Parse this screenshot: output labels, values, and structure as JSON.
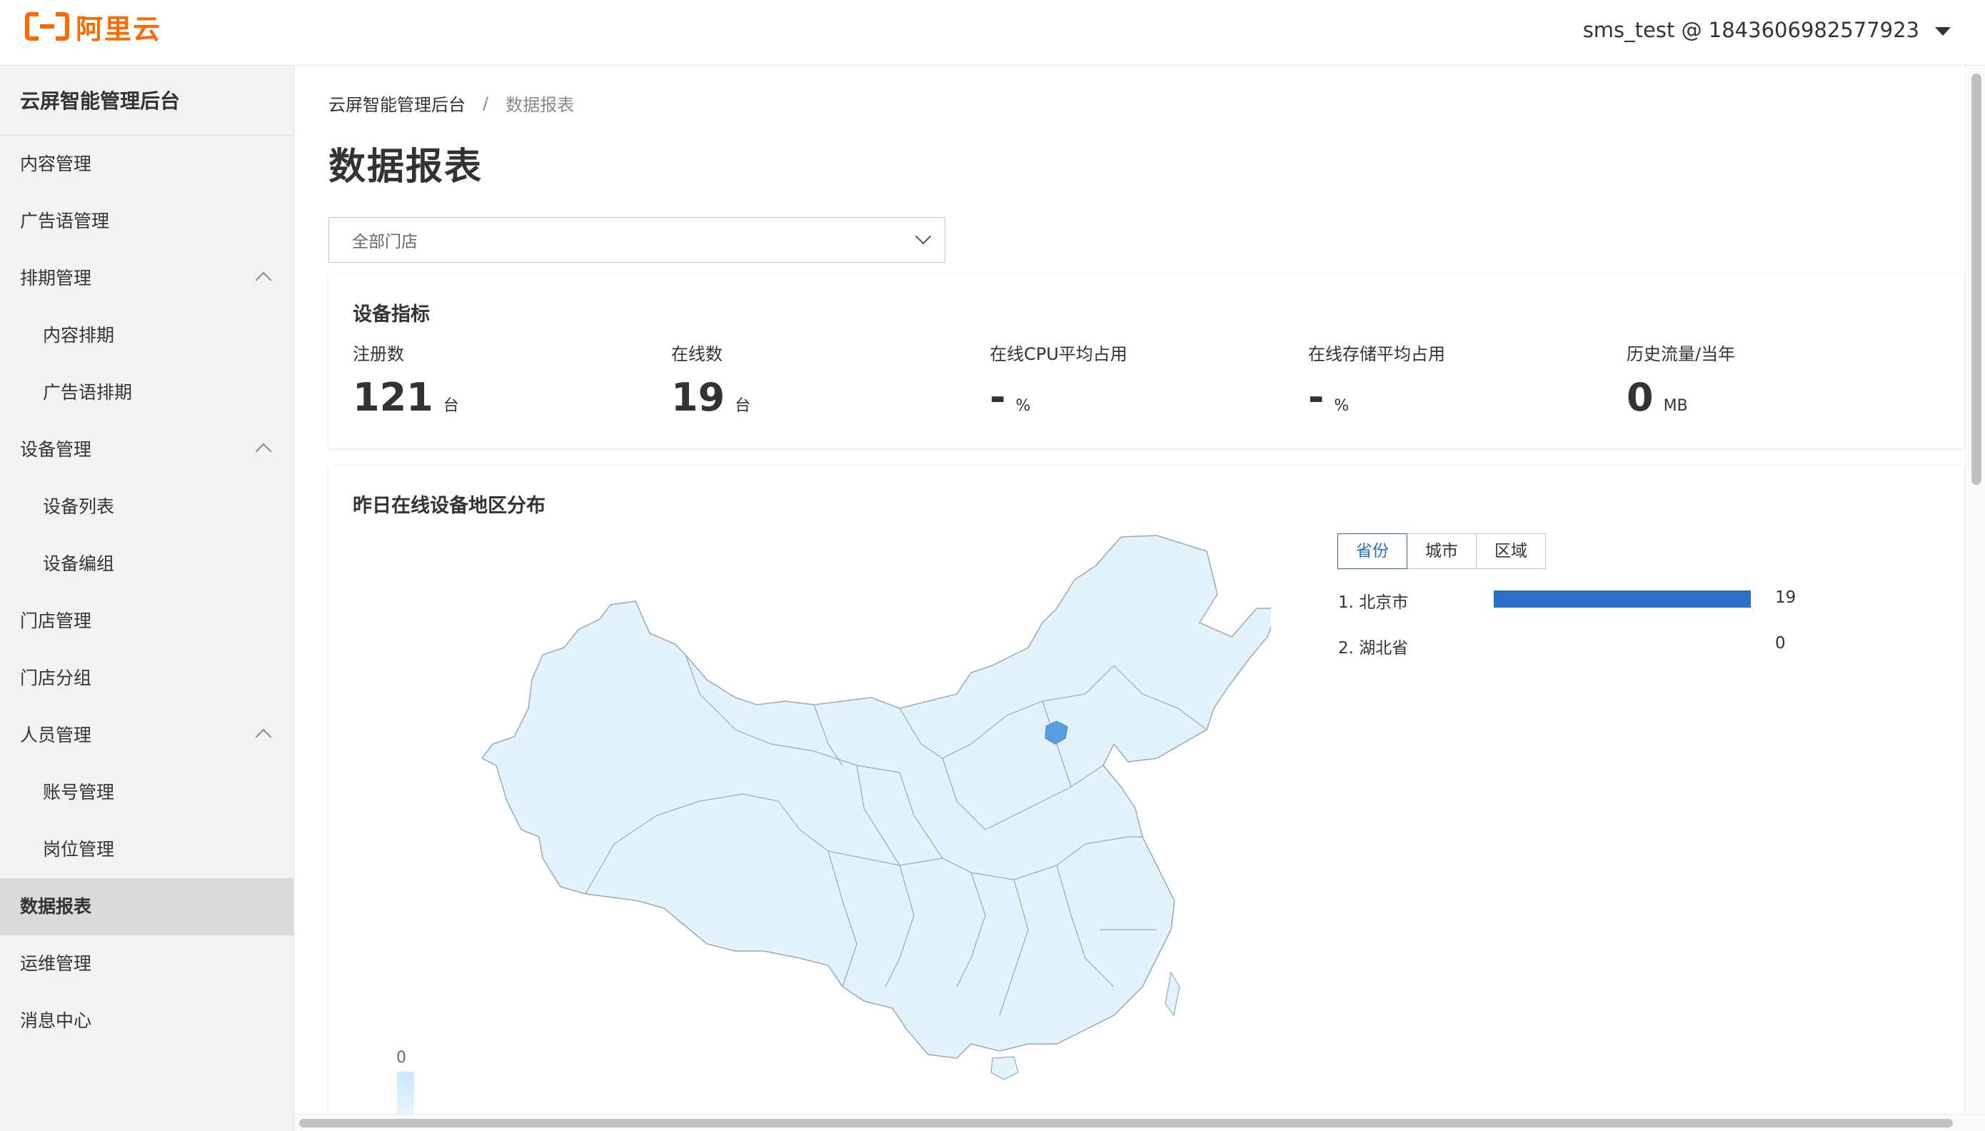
{
  "header": {
    "logo_text": "阿里云",
    "account": "sms_test @ 1843606982577923",
    "brand_color": "#ff6a00"
  },
  "sidebar": {
    "title": "云屏智能管理后台",
    "items": [
      {
        "label": "内容管理"
      },
      {
        "label": "广告语管理"
      },
      {
        "label": "排期管理"
      },
      {
        "label": "内容排期"
      },
      {
        "label": "广告语排期"
      },
      {
        "label": "设备管理"
      },
      {
        "label": "设备列表"
      },
      {
        "label": "设备编组"
      },
      {
        "label": "门店管理"
      },
      {
        "label": "门店分组"
      },
      {
        "label": "人员管理"
      },
      {
        "label": "账号管理"
      },
      {
        "label": "岗位管理"
      },
      {
        "label": "数据报表"
      },
      {
        "label": "运维管理"
      },
      {
        "label": "消息中心"
      }
    ]
  },
  "breadcrumb": {
    "root": "云屏智能管理后台",
    "separator": "/",
    "current": "数据报表"
  },
  "page": {
    "title": "数据报表",
    "store_select": "全部门店"
  },
  "metrics": {
    "title": "设备指标",
    "items": [
      {
        "label": "注册数",
        "value": "121",
        "unit": "台"
      },
      {
        "label": "在线数",
        "value": "19",
        "unit": "台"
      },
      {
        "label": "在线CPU平均占用",
        "value": "-",
        "unit": "%"
      },
      {
        "label": "在线存储平均占用",
        "value": "-",
        "unit": "%"
      },
      {
        "label": "历史流量/当年",
        "value": "0",
        "unit": "MB"
      }
    ]
  },
  "distribution": {
    "title": "昨日在线设备地区分布",
    "legend_min": "0",
    "tabs": [
      "省份",
      "城市",
      "区域"
    ],
    "active_tab": "省份",
    "ranking": [
      {
        "label": "1. 北京市",
        "value": "19",
        "fraction": 1.0
      },
      {
        "label": "2. 湖北省",
        "value": "0",
        "fraction": 0.0
      }
    ],
    "accent_color": "#2a6ec8",
    "map_fill": "#e3f3fd",
    "highlight_fill": "#5b9ee0"
  }
}
